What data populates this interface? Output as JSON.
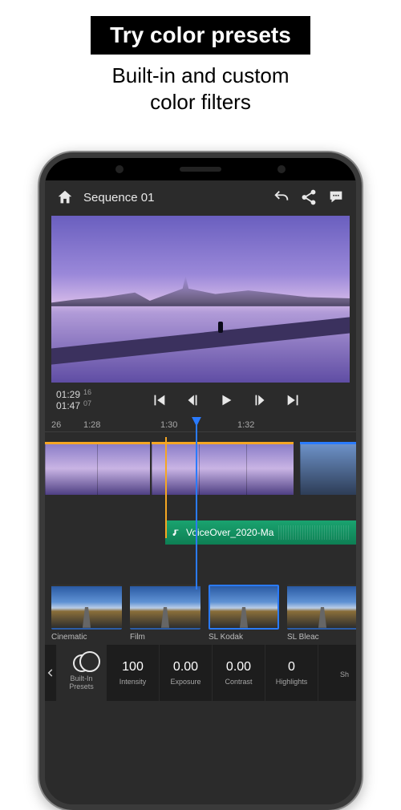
{
  "promo": {
    "banner": "Try color presets",
    "subtitle": "Built-in and custom\ncolor filters"
  },
  "topbar": {
    "title": "Sequence 01"
  },
  "transport": {
    "current_tc": "01:29",
    "current_frames": "16",
    "total_tc": "01:47",
    "total_frames": "07"
  },
  "ruler": {
    "ticks": [
      "26",
      "1:28",
      "1:30",
      "1:32"
    ]
  },
  "timeline": {
    "audio_clip_label": "VoiceOver_2020-Ma"
  },
  "presets": {
    "items": [
      {
        "label": "Cinematic",
        "selected": false
      },
      {
        "label": "Film",
        "selected": false
      },
      {
        "label": "SL Kodak",
        "selected": true
      },
      {
        "label": "SL Bleac",
        "selected": false
      }
    ]
  },
  "params": {
    "builtin_label": "Built-In\nPresets",
    "cells": [
      {
        "value": "100",
        "label": "Intensity"
      },
      {
        "value": "0.00",
        "label": "Exposure"
      },
      {
        "value": "0.00",
        "label": "Contrast"
      },
      {
        "value": "0",
        "label": "Highlights"
      },
      {
        "value": "",
        "label": "Sh"
      }
    ]
  }
}
